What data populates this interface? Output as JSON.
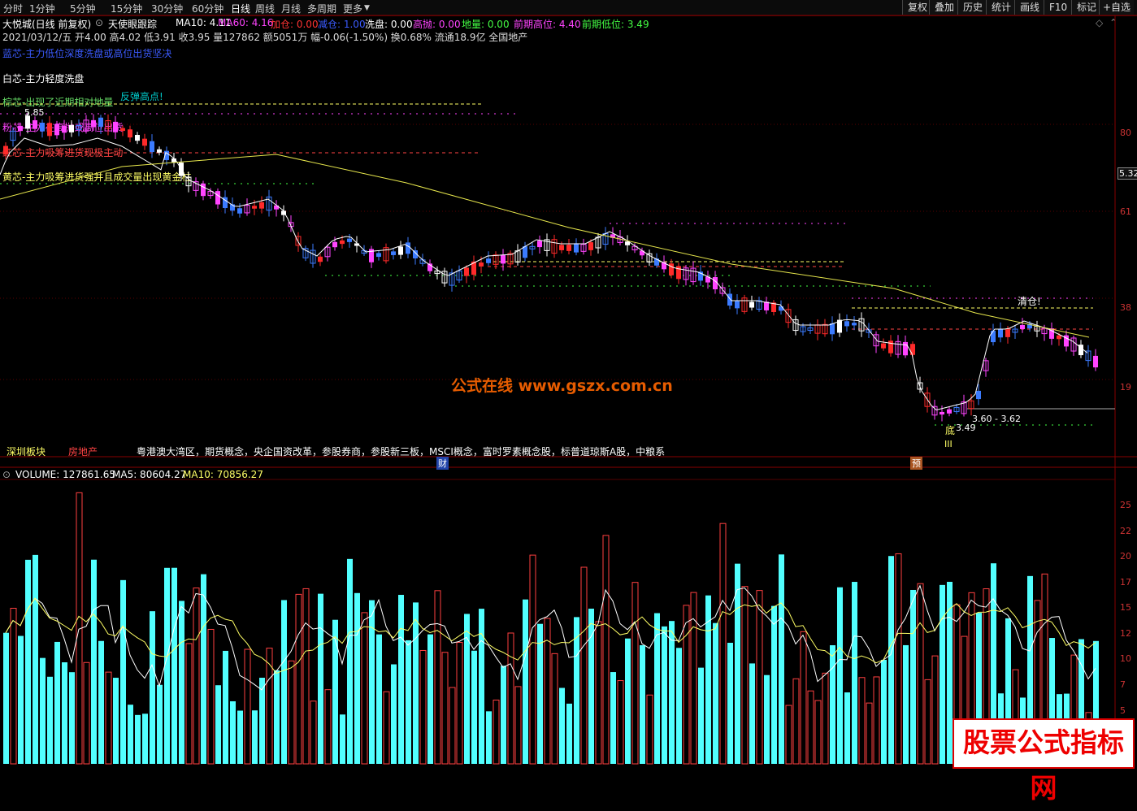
{
  "toolbar": {
    "periods": [
      "分时",
      "1分钟",
      "5分钟",
      "15分钟",
      "30分钟",
      "60分钟",
      "日线",
      "周线",
      "月线",
      "多周期",
      "更多"
    ],
    "active_period": "日线",
    "right_buttons": [
      "复权",
      "叠加",
      "历史",
      "统计",
      "画线",
      "F10",
      "标记",
      "+自选"
    ]
  },
  "header": {
    "stock": "大悦城(日线 前复权)",
    "indicator": "天使眼跟踪",
    "ma10": "MA10: 4.11",
    "ma60": "MA60: 4.16",
    "jiacang": "加仓: 0.00",
    "jiancang": "减仓: 1.00",
    "xipan": "洗盘: 0.00",
    "gaopao": "高抛: 0.00",
    "diliang": "地量: 0.00",
    "high_label": "前期高位: 4.40",
    "low_label": "前期低位: 3.49",
    "quote": "2021/03/12/五 开4.00 高4.02 低3.91 收3.95 量127862 额5051万 幅-0.06(-1.50%) 换0.68% 流通18.9亿 全国地产",
    "colors": {
      "up": "#ff2a2a",
      "down": "#3b7bff",
      "ma": "#ffffff",
      "ma60": "#e6e64c",
      "volume_up": "#ff4040",
      "volume_down": "#52ffff"
    }
  },
  "legend": [
    {
      "text": "蓝芯-主力低位深度洗盘或高位出货坚决",
      "color": "#3b5bff"
    },
    {
      "text": "白芯-主力轻度洗盘",
      "color": "#ffffff"
    },
    {
      "text": "棕芯-出现了近期相对地量",
      "color": "#66dd66"
    },
    {
      "text": "粉芯-主力在高抛或高位出货",
      "color": "#ff44ff"
    },
    {
      "text": "红芯-主力吸筹进货现极主动",
      "color": "#ff4444"
    },
    {
      "text": "黄芯-主力吸筹进货强并且成交量出现黄金柱",
      "color": "#ffff66"
    }
  ],
  "annotations": {
    "fantan": "反弹高点!",
    "top_price": "5.85",
    "qingcang": "清仓!",
    "di": "底",
    "di_price": "3.49",
    "iii": "III",
    "range": "3.60 - 3.62",
    "price_box": "5.32"
  },
  "right_axis": [
    "80",
    "61",
    "38",
    "19"
  ],
  "bottom": {
    "block_label": "深圳板块",
    "sector": "房地产",
    "concepts": "粤港澳大湾区，期货概念，央企国资改革，参股券商，参股新三板，MSCI概念，富时罗素概念股，标普道琼斯A股，中粮系",
    "cai": "财",
    "yu": "预"
  },
  "volume": {
    "label": "VOLUME: 127861.65",
    "ma5": "MA5: 80604.27",
    "ma10": "MA10: 70856.27",
    "axis": [
      "25",
      "22",
      "20",
      "17",
      "15",
      "12",
      "10",
      "7",
      "5"
    ]
  },
  "watermarks": {
    "site": "公式在线  www.gszx.com.cn",
    "brand": "股票公式指标网"
  }
}
